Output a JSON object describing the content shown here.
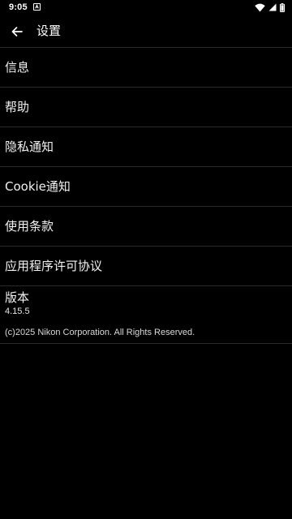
{
  "status_bar": {
    "time": "9:05",
    "icons": [
      "notification-icon",
      "wifi-icon",
      "signal-icon",
      "battery-icon"
    ]
  },
  "app_bar": {
    "back_icon": "arrow-back-icon",
    "title": "设置"
  },
  "settings": {
    "items": [
      {
        "label": "信息"
      },
      {
        "label": "帮助"
      },
      {
        "label": "隐私通知"
      },
      {
        "label": "Cookie通知"
      },
      {
        "label": "使用条款"
      },
      {
        "label": "应用程序许可协议"
      }
    ],
    "version": {
      "label": "版本",
      "number": "4.15.5",
      "copyright": "(c)2025 Nikon Corporation. All Rights Reserved."
    }
  },
  "colors": {
    "background": "#000000",
    "text": "#ffffff",
    "divider": "#2a2a2a"
  }
}
